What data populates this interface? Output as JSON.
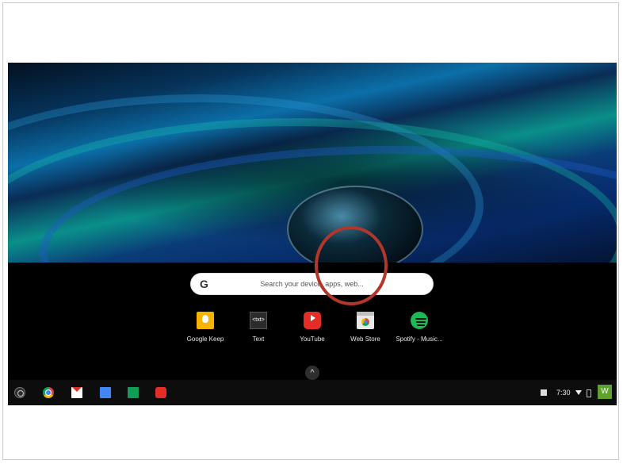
{
  "search": {
    "placeholder": "Search your device, apps, web...",
    "logo": "G"
  },
  "apps": [
    {
      "label": "Google Keep",
      "icon": "google-keep-icon"
    },
    {
      "label": "Text",
      "icon": "text-editor-icon",
      "glyph": "<txt>"
    },
    {
      "label": "YouTube",
      "icon": "youtube-icon"
    },
    {
      "label": "Web Store",
      "icon": "web-store-icon",
      "highlighted": true
    },
    {
      "label": "Spotify - Music...",
      "icon": "spotify-icon"
    }
  ],
  "expand": {
    "glyph": "^"
  },
  "shelf": {
    "pinned": [
      "launcher-icon",
      "chrome-icon",
      "gmail-icon",
      "docs-icon",
      "sheets-icon",
      "youtube-icon"
    ],
    "clock": "7:30",
    "avatar_initial": "W"
  },
  "colors": {
    "highlight_circle": "#b2372b",
    "shelf": "#0d0d0d",
    "avatar": "#5fa02e"
  }
}
